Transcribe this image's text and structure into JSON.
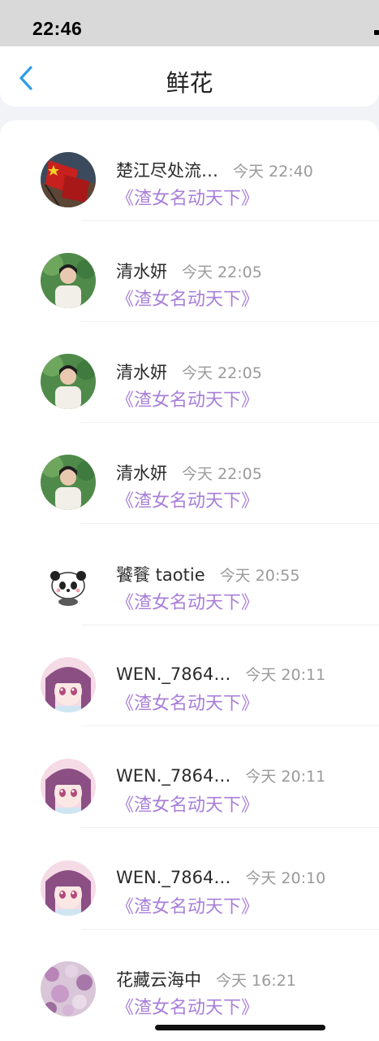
{
  "status": {
    "time": "22:46"
  },
  "nav": {
    "title": "鲜花",
    "back_icon": "chevron-left-icon",
    "accent": "#2f9be8"
  },
  "colors": {
    "gift_text": "#a77fd8",
    "time_text": "#9a9a9a"
  },
  "records": [
    {
      "name": "楚江尽处流…",
      "time": "今天 22:40",
      "gift": "《渣女名动天下》",
      "avatar": "flag"
    },
    {
      "name": "清水妍",
      "time": "今天 22:05",
      "gift": "《渣女名动天下》",
      "avatar": "person"
    },
    {
      "name": "清水妍",
      "time": "今天 22:05",
      "gift": "《渣女名动天下》",
      "avatar": "person"
    },
    {
      "name": "清水妍",
      "time": "今天 22:05",
      "gift": "《渣女名动天下》",
      "avatar": "person"
    },
    {
      "name": "饕餮 taotie",
      "time": "今天 20:55",
      "gift": "《渣女名动天下》",
      "avatar": "panda"
    },
    {
      "name": "WEN._7864…",
      "time": "今天 20:11",
      "gift": "《渣女名动天下》",
      "avatar": "anime"
    },
    {
      "name": "WEN._7864…",
      "time": "今天 20:11",
      "gift": "《渣女名动天下》",
      "avatar": "anime"
    },
    {
      "name": "WEN._7864…",
      "time": "今天 20:10",
      "gift": "《渣女名动天下》",
      "avatar": "anime"
    },
    {
      "name": "花藏云海中",
      "time": "今天 16:21",
      "gift": "《渣女名动天下》",
      "avatar": "flowers"
    }
  ]
}
